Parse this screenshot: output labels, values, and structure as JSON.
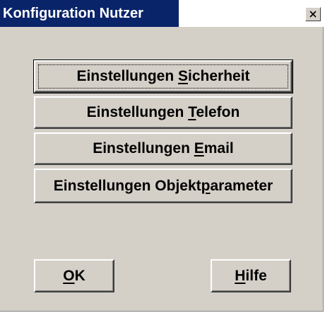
{
  "window": {
    "title": "Konfiguration Nutzer",
    "close_icon": "close-icon"
  },
  "buttons": {
    "security": {
      "before": "Einstellungen ",
      "mnemonic": "S",
      "after": "icherheit"
    },
    "phone": {
      "before": "Einstellungen ",
      "mnemonic": "T",
      "after": "elefon"
    },
    "email": {
      "before": "Einstellungen ",
      "mnemonic": "E",
      "after": "mail"
    },
    "object_params": {
      "before": "Einstellungen Objekt",
      "mnemonic": "p",
      "after": "arameter"
    },
    "ok": {
      "before": "",
      "mnemonic": "O",
      "after": "K"
    },
    "help": {
      "before": "",
      "mnemonic": "H",
      "after": "ilfe"
    }
  },
  "colors": {
    "title_bar": "#0a246a",
    "dialog_face": "#d4d0c8"
  }
}
